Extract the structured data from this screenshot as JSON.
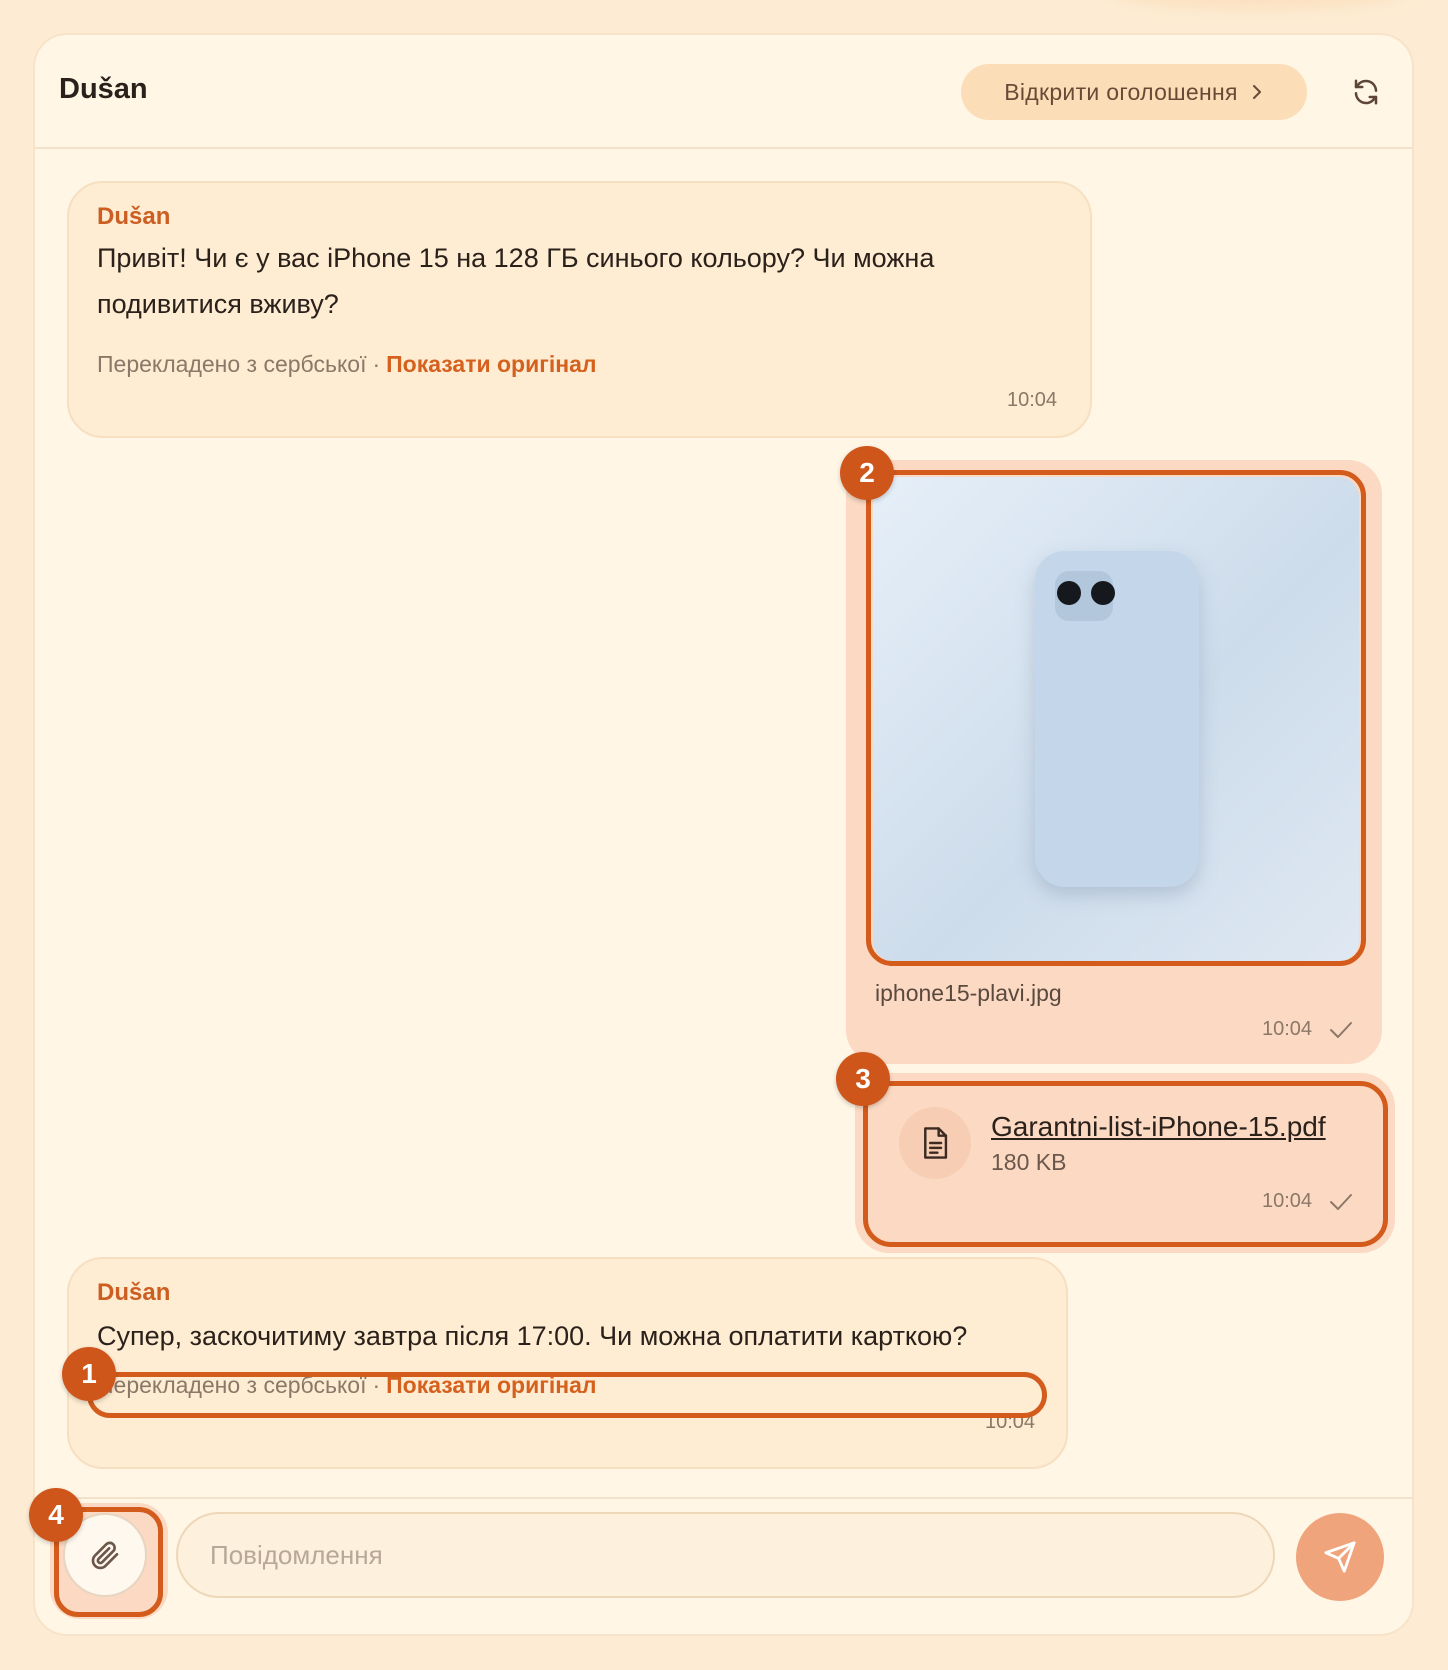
{
  "header": {
    "contact_name": "Dušan",
    "open_listing_label": "Відкрити оголошення"
  },
  "messages": [
    {
      "direction": "incoming",
      "sender": "Dušan",
      "text_line1": "Привіт! Чи є у вас iPhone 15 на 128 ГБ синього кольору? Чи можна",
      "text_line2": "подивитися вживу?",
      "translated_note": "Перекладено з сербської",
      "show_original_label": "Показати оригінал",
      "time": "10:04"
    },
    {
      "direction": "outgoing",
      "type": "image",
      "filename": "iphone15-plavi.jpg",
      "time": "10:04",
      "status": "sent"
    },
    {
      "direction": "outgoing",
      "type": "file",
      "filename": "Garantni-list-iPhone-15.pdf",
      "size": "180 KB",
      "time": "10:04",
      "status": "sent"
    },
    {
      "direction": "incoming",
      "sender": "Dušan",
      "text": "Супер, заскочитиму завтра після 17:00. Чи можна оплатити карткою?",
      "translated_note": "Перекладено з сербської",
      "show_original_label": "Показати оригінал",
      "time": "10:04"
    }
  ],
  "annotations": [
    "1",
    "2",
    "3",
    "4"
  ],
  "composer": {
    "placeholder": "Повідомлення"
  },
  "colors": {
    "accent": "#cf561a",
    "link": "#d5611f",
    "incoming_bubble": "#feecd3",
    "outgoing_bubble": "#fcd9c3",
    "send_button": "#f0a47c"
  },
  "icons": [
    "chevron-right-icon",
    "refresh-icon",
    "document-icon",
    "checkmark-icon",
    "paperclip-icon",
    "send-icon"
  ]
}
